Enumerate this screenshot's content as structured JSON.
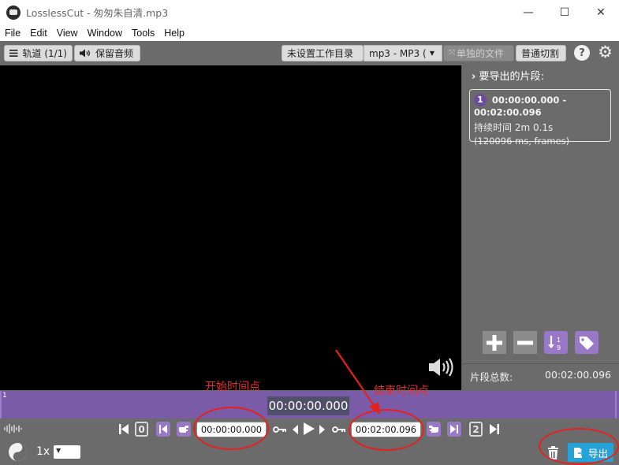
{
  "window": {
    "title": "LosslessCut - 匆匆朱自清.mp3",
    "controls": {
      "minimize": "—",
      "maximize": "☐",
      "close": "✕"
    }
  },
  "menu": [
    "File",
    "Edit",
    "View",
    "Window",
    "Tools",
    "Help"
  ],
  "toolbar": {
    "tracks_label": "轨道 (1/1)",
    "keep_audio_label": "保留音频",
    "workdir_label": "未设置工作目录",
    "format_label": "mp3 - MP3 (",
    "separate_files_label": "单独的文件",
    "cut_mode_label": "普通切割",
    "help_label": "?"
  },
  "segments_panel": {
    "header": "要导出的片段:",
    "segments": [
      {
        "index": "1",
        "range": "00:00:00.000 - 00:02:00.096",
        "duration": "持续时间 2m 0.1s",
        "details": "(120096 ms, frames)"
      }
    ],
    "total_label": "片段总数:",
    "total_value": "00:02:00.096"
  },
  "timeline": {
    "marker_label": "1",
    "current_time": "00:00:00.000"
  },
  "controls": {
    "zero_label": "0",
    "start_time": "00:00:00.000",
    "end_time": "00:02:00.096",
    "two_label": "2",
    "rate_label": "1x",
    "export_label": "导出"
  },
  "annotations": {
    "start_label": "开始时间点",
    "end_label": "结束时间点",
    "color": "#e53030"
  },
  "colors": {
    "accent_purple": "#9a78c8",
    "export_blue": "#25a3d8",
    "background": "#6b6b6b"
  }
}
